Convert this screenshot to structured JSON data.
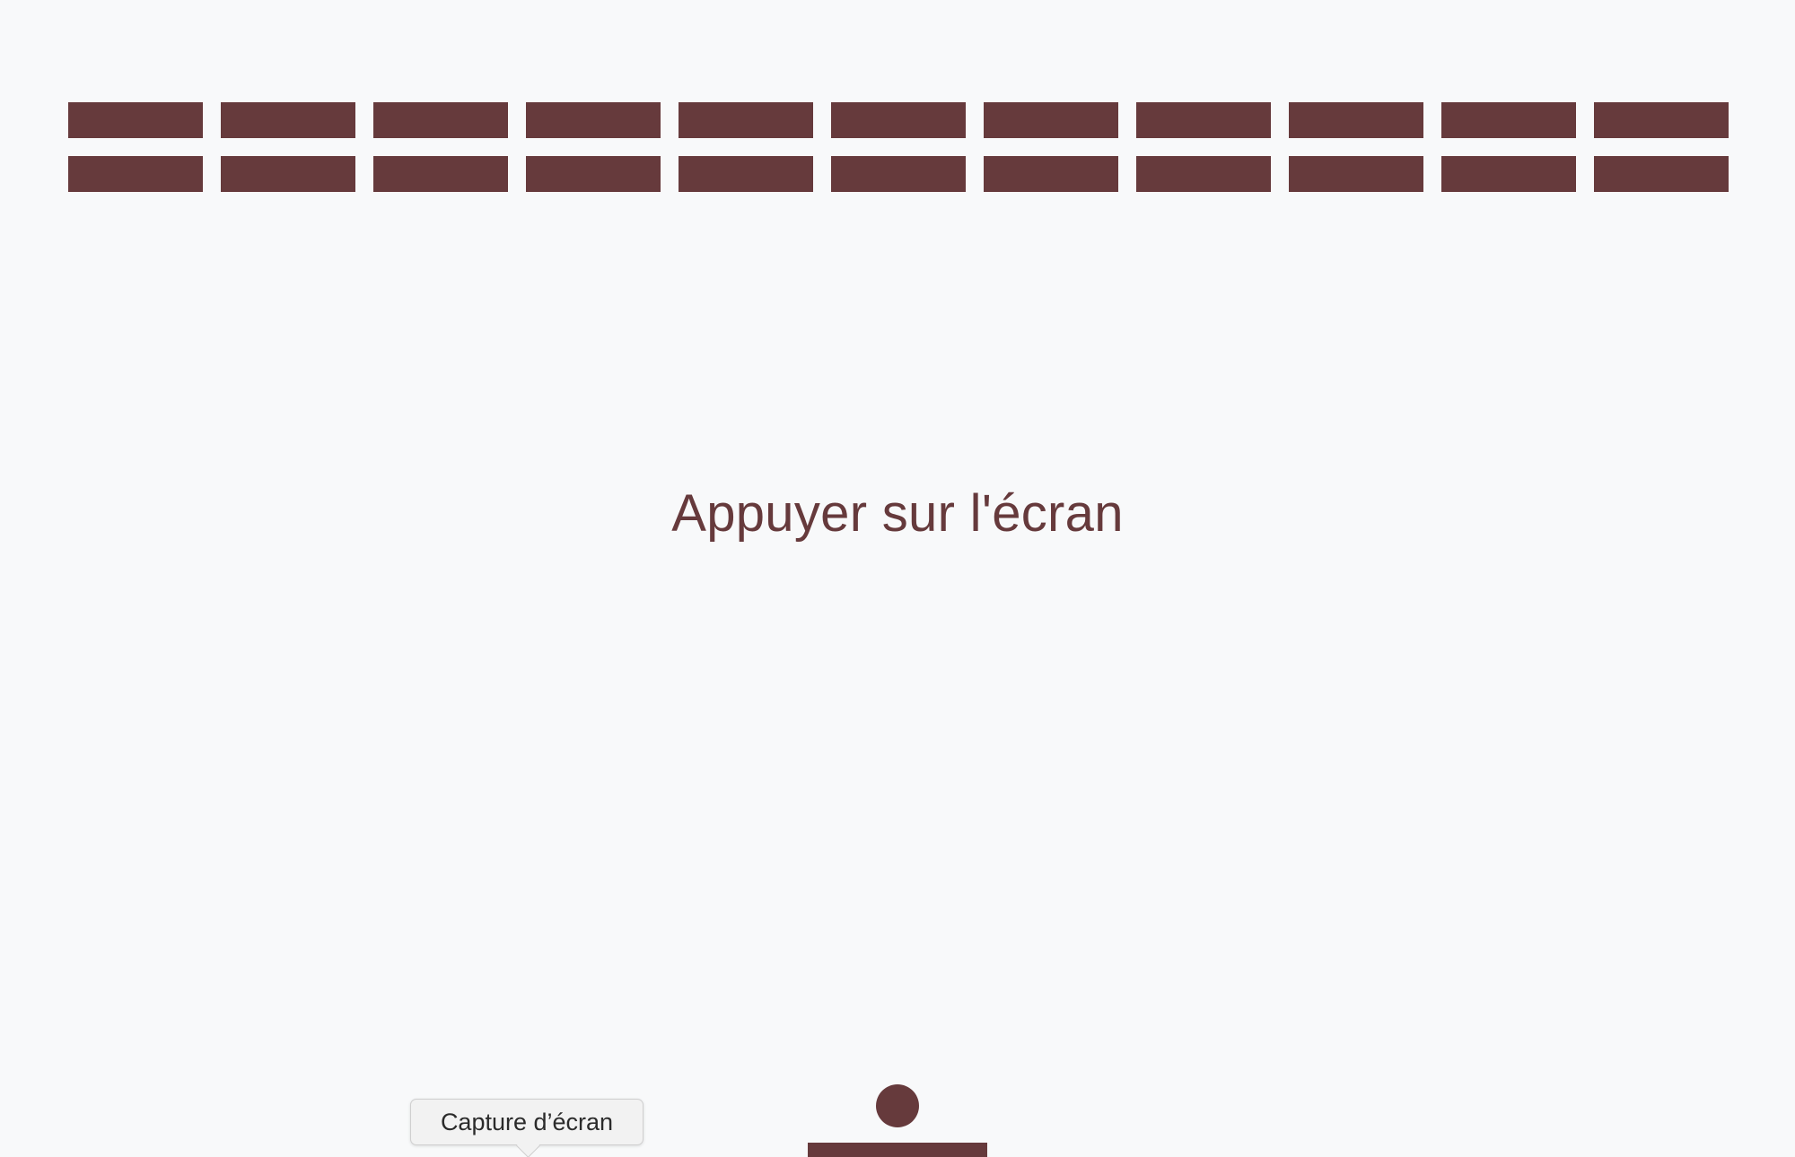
{
  "game": {
    "prompt": "Appuyer sur l'écran",
    "brick_rows": 2,
    "bricks_per_row": 11,
    "colors": {
      "background": "#f8f9fa",
      "bricks": "#663a3c",
      "ball": "#663a3c",
      "paddle": "#663a3c",
      "text": "#663a3c"
    }
  },
  "tooltip": {
    "label": "Capture d’écran"
  }
}
